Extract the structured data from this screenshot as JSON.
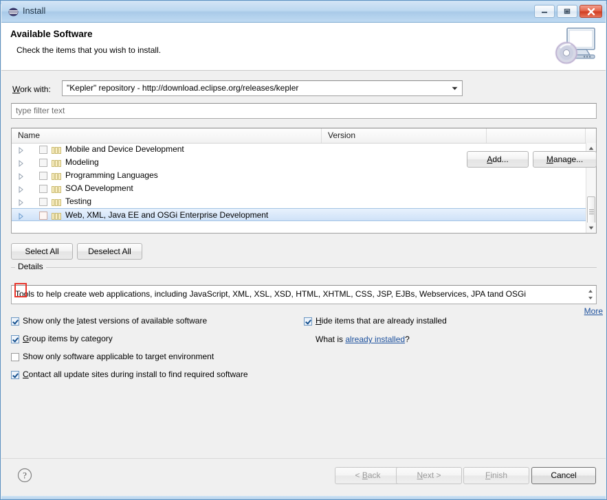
{
  "window": {
    "title": "Install",
    "icon": "eclipse-icon",
    "controls": {
      "minimize": "minimize-button",
      "maximize": "maximize-button",
      "close": "close-button"
    }
  },
  "header": {
    "title": "Available Software",
    "subtitle": "Check the items that you wish to install.",
    "graphic": "computer-disc-icon"
  },
  "work_with": {
    "label_prefix": "W",
    "label_rest": "ork with:",
    "value": "\"Kepler\" repository - http://download.eclipse.org/releases/kepler",
    "add_button": {
      "mnemonic": "A",
      "rest": "dd..."
    },
    "manage_button": {
      "mnemonic": "M",
      "rest": "anage..."
    }
  },
  "filter": {
    "placeholder": "type filter text",
    "value": ""
  },
  "tree": {
    "columns": [
      "Name",
      "Version",
      ""
    ],
    "rows": [
      {
        "label": "Mobile and Device Development",
        "version": "",
        "checked": false,
        "expanded": false,
        "selected": false
      },
      {
        "label": "Modeling",
        "version": "",
        "checked": false,
        "expanded": false,
        "selected": false
      },
      {
        "label": "Programming Languages",
        "version": "",
        "checked": false,
        "expanded": false,
        "selected": false
      },
      {
        "label": "SOA Development",
        "version": "",
        "checked": false,
        "expanded": false,
        "selected": false
      },
      {
        "label": "Testing",
        "version": "",
        "checked": false,
        "expanded": false,
        "selected": false
      },
      {
        "label": "Web, XML, Java EE and OSGi Enterprise Development",
        "version": "",
        "checked": false,
        "expanded": false,
        "selected": true
      }
    ],
    "annotation_color": "#e8352b"
  },
  "selection_buttons": {
    "select_all": "Select All",
    "deselect_all": "Deselect All"
  },
  "details": {
    "group_label": "Details",
    "text": "Tools to help create web applications, including JavaScript, XML, XSL, XSD, HTML, XHTML, CSS, JSP, EJBs, Webservices, JPA tand OSGi",
    "more_link": "More"
  },
  "options": {
    "latest": {
      "mnemonic_pre": "Show only the ",
      "mnemonic": "l",
      "rest": "atest versions of available software",
      "checked": true
    },
    "group": {
      "mnemonic_pre": "",
      "mnemonic": "G",
      "rest": "roup items by category",
      "checked": true
    },
    "target": {
      "mnemonic_pre": "",
      "mnemonic": "S",
      "rest": "how only software applicable to target environment",
      "checked": false
    },
    "contact": {
      "mnemonic_pre": "",
      "mnemonic": "C",
      "rest": "ontact all update sites during install to find required software",
      "checked": true
    },
    "hide": {
      "mnemonic_pre": "",
      "mnemonic": "H",
      "rest": "ide items that are already installed",
      "checked": true
    },
    "whatis_prefix": "What is ",
    "whatis_link": "already installed",
    "whatis_suffix": "?"
  },
  "footer": {
    "help": "?",
    "back": {
      "pre": "< ",
      "mnemonic": "B",
      "rest": "ack"
    },
    "next": {
      "pre": "",
      "mnemonic": "N",
      "rest": "ext >"
    },
    "finish": {
      "pre": "",
      "mnemonic": "F",
      "rest": "inish"
    },
    "cancel": {
      "pre": "",
      "mnemonic": "",
      "rest": "Cancel"
    }
  },
  "colors": {
    "accent": "#1b4f9c",
    "selection": "#cfe2f8",
    "annotation": "#e8352b",
    "close": "#cf3c20"
  }
}
